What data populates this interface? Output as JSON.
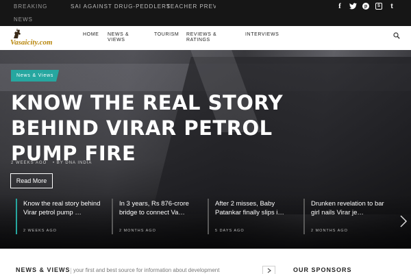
{
  "ticker": {
    "label_line1": "BREAKING",
    "label_line2": "NEWS",
    "items": [
      "SAI AGAINST DRUG-PEDDLERS",
      "TEACHER PREVENT"
    ]
  },
  "social": {
    "facebook": "f",
    "twitter": "t",
    "pinterest": "p",
    "skype": "S",
    "tumblr": "t",
    "icons": [
      "facebook-icon",
      "twitter-icon",
      "pinterest-icon",
      "skype-icon",
      "tumblr-icon"
    ]
  },
  "brand": {
    "logo_text": "Vasaicity.com",
    "accent_color": "#26a7a0"
  },
  "nav": {
    "items": [
      "HOME",
      "NEWS & VIEWS",
      "TOURISM",
      "REVIEWS & RATINGS",
      "INTERVIEWS"
    ]
  },
  "hero": {
    "category": "News & Views",
    "title": "KNOW THE REAL STORY BEHIND VIRAR PETROL PUMP FIRE",
    "date": "2 WEEKS AGO",
    "author": "• BY DNA INDIA",
    "read_more": "Read More"
  },
  "carousel": {
    "slides": [
      {
        "title": "Know the real story behind Virar petrol pump …",
        "date": "2 WEEKS AGO"
      },
      {
        "title": "In 3 years, Rs 876-crore bridge to connect Va…",
        "date": "2 MONTHS AGO"
      },
      {
        "title": "After 2 misses, Baby Patankar finally slips i…",
        "date": "5 DAYS AGO"
      },
      {
        "title": "Drunken revelation to bar girl nails Virar je…",
        "date": "2 MONTHS AGO"
      }
    ]
  },
  "section": {
    "title": "NEWS & VIEWS",
    "subtitle": "your first and best source for information about development",
    "sponsors_title": "OUR SPONSORS"
  }
}
